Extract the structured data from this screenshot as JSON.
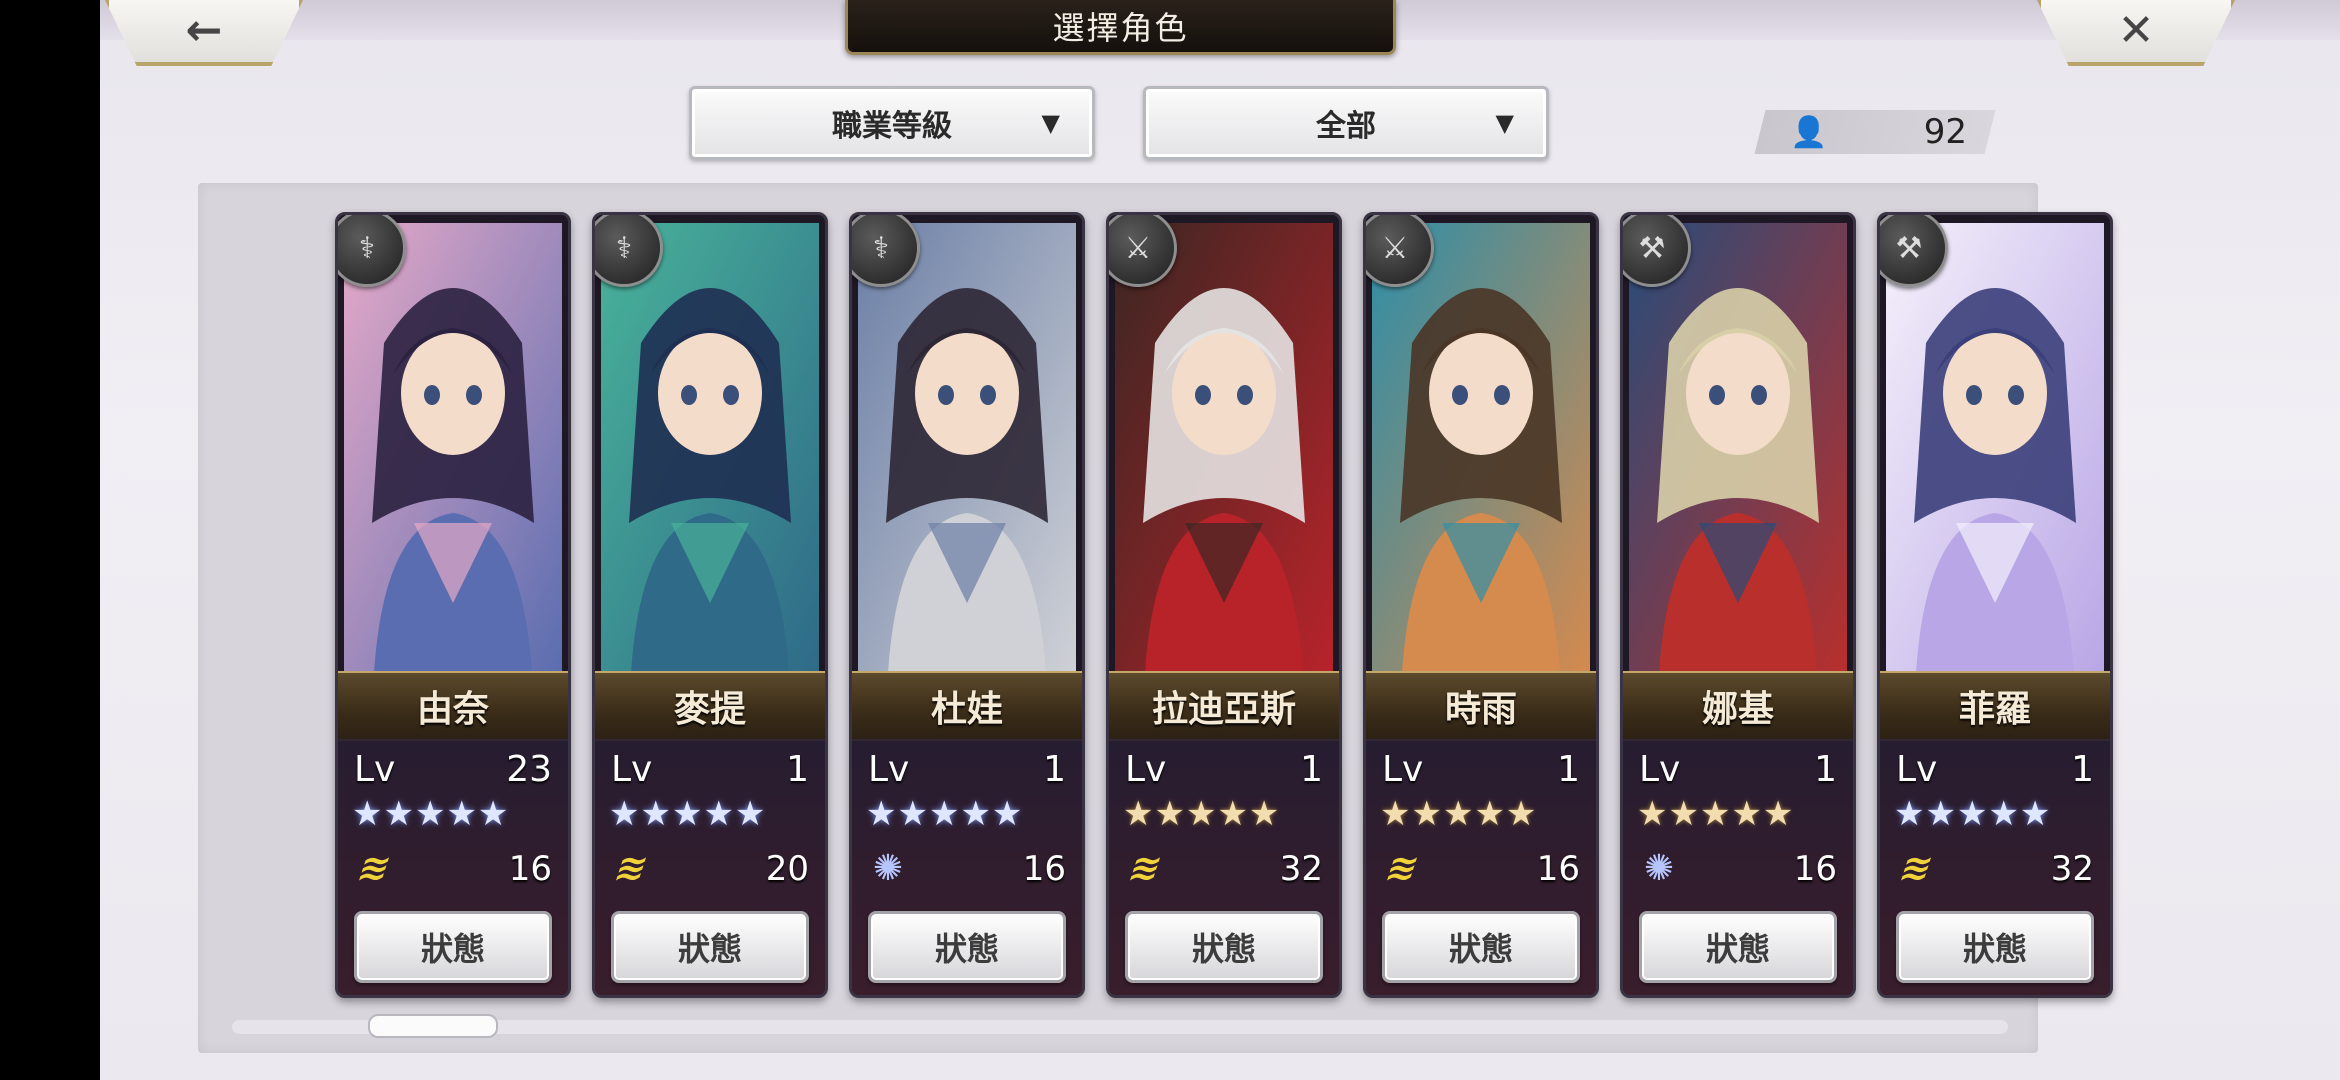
{
  "header": {
    "title": "選擇角色",
    "back_icon": "←",
    "close_icon": "✕"
  },
  "filters": {
    "sort": {
      "label": "職業等級",
      "chevron": "▼"
    },
    "category": {
      "label": "全部",
      "chevron": "▼"
    }
  },
  "roster": {
    "person_icon": "👤",
    "count": "92"
  },
  "cards": [
    {
      "name": "由奈",
      "lv_label": "Lv",
      "level": "23",
      "stars": "★★★★★",
      "star_style": "blue",
      "element": "wind",
      "element_glyph": "≋",
      "value": "16",
      "status": "狀態",
      "class_glyph": "⚕",
      "colors": [
        "#5a6db0",
        "#e6a9c8",
        "#2b2140"
      ]
    },
    {
      "name": "麥提",
      "lv_label": "Lv",
      "level": "1",
      "stars": "★★★★★",
      "star_style": "blue",
      "element": "wind",
      "element_glyph": "≋",
      "value": "20",
      "status": "狀態",
      "class_glyph": "⚕",
      "colors": [
        "#2f6a88",
        "#48b39a",
        "#1f2f52"
      ]
    },
    {
      "name": "杜娃",
      "lv_label": "Lv",
      "level": "1",
      "stars": "★★★★★",
      "star_style": "blue",
      "element": "swirl",
      "element_glyph": "✺",
      "value": "16",
      "status": "狀態",
      "class_glyph": "⚕",
      "colors": [
        "#cfd1d6",
        "#6b7fa6",
        "#2d2735"
      ]
    },
    {
      "name": "拉迪亞斯",
      "lv_label": "Lv",
      "level": "1",
      "stars": "★★★★★",
      "star_style": "gold",
      "element": "wind",
      "element_glyph": "≋",
      "value": "32",
      "status": "狀態",
      "class_glyph": "⚔",
      "colors": [
        "#b8232a",
        "#3a2622",
        "#e5e2e2"
      ]
    },
    {
      "name": "時雨",
      "lv_label": "Lv",
      "level": "1",
      "stars": "★★★★★",
      "star_style": "gold",
      "element": "wind",
      "element_glyph": "≋",
      "value": "16",
      "status": "狀態",
      "class_glyph": "⚔",
      "colors": [
        "#d58a4e",
        "#2d8ea8",
        "#4a3526"
      ]
    },
    {
      "name": "娜基",
      "lv_label": "Lv",
      "level": "1",
      "stars": "★★★★★",
      "star_style": "gold",
      "element": "swirl",
      "element_glyph": "✺",
      "value": "16",
      "status": "狀態",
      "class_glyph": "⚒",
      "colors": [
        "#b82f2c",
        "#274c7a",
        "#d8cfa8"
      ]
    },
    {
      "name": "菲羅",
      "lv_label": "Lv",
      "level": "1",
      "stars": "★★★★★",
      "star_style": "blue",
      "element": "wind",
      "element_glyph": "≋",
      "value": "32",
      "status": "狀態",
      "class_glyph": "⚒",
      "colors": [
        "#b9a6e6",
        "#f5f1fb",
        "#3b3f7a"
      ]
    }
  ]
}
